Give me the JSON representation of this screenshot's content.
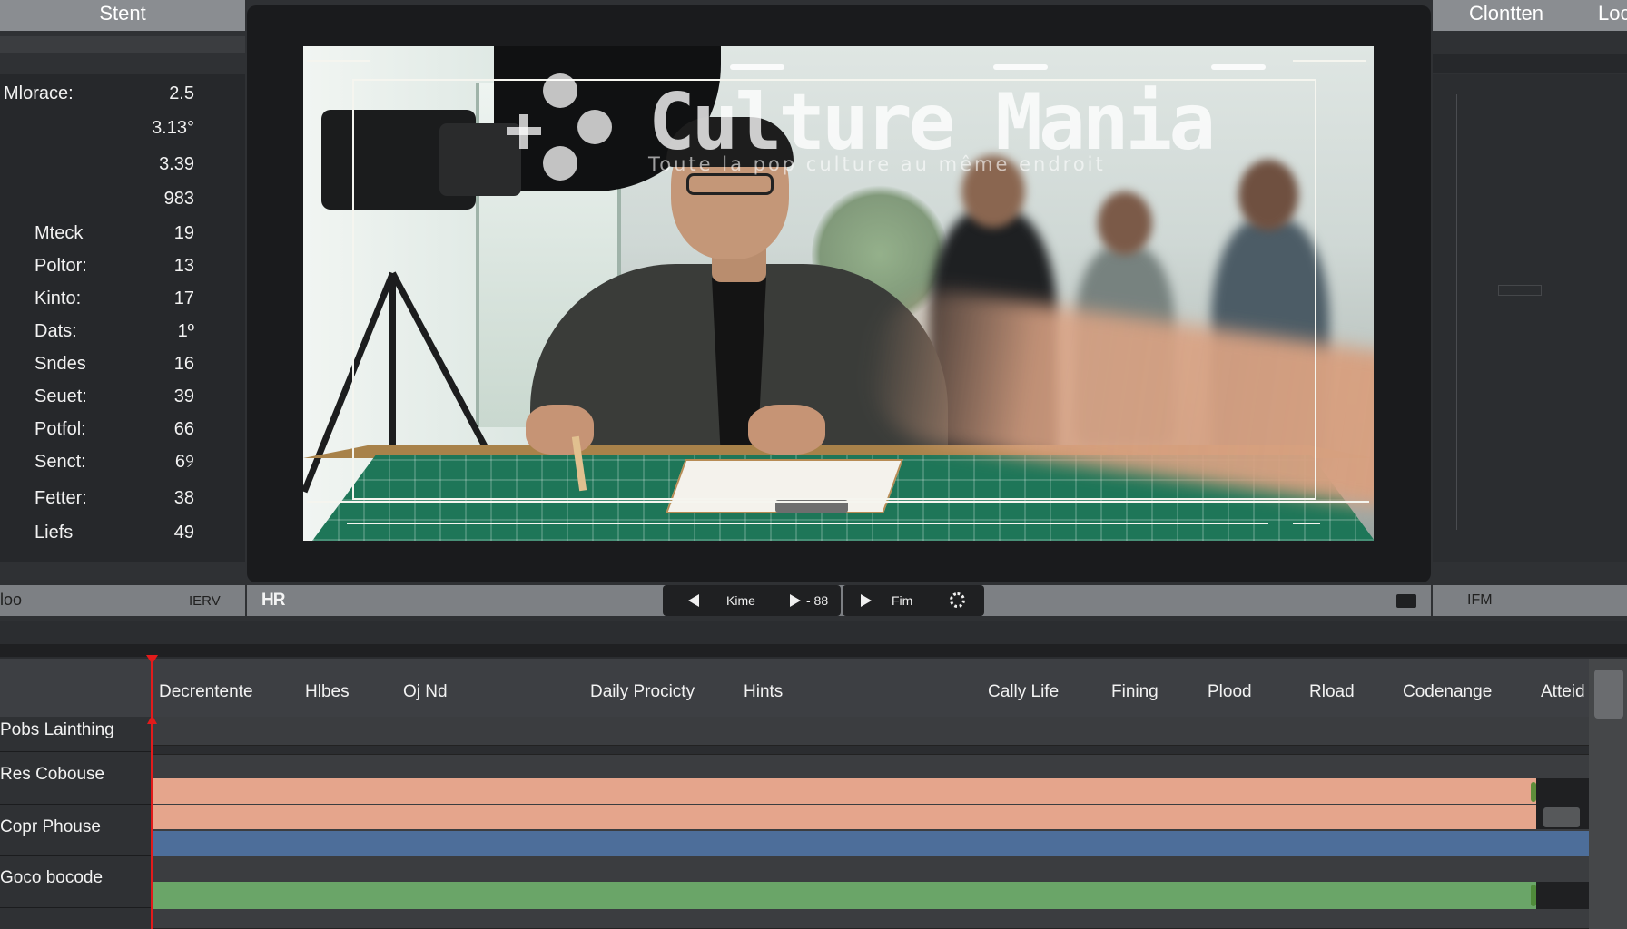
{
  "left_panel": {
    "title": "Stent",
    "properties": [
      {
        "label": "Mlorace:",
        "value": "2.5"
      },
      {
        "label": "",
        "value": "3.13°"
      },
      {
        "label": "",
        "value": "3.39"
      },
      {
        "label": "",
        "value": "983"
      },
      {
        "label": "Mteck",
        "value": "19"
      },
      {
        "label": "Poltor:",
        "value": "13"
      },
      {
        "label": "Kinto:",
        "value": "17"
      },
      {
        "label": "Dats:",
        "value": "1º"
      },
      {
        "label": "Sndes",
        "value": "16"
      },
      {
        "label": "Seuet:",
        "value": "39"
      },
      {
        "label": "Potfol:",
        "value": "66"
      },
      {
        "label": "Senct:",
        "value": "6୨"
      },
      {
        "label": "Fetter:",
        "value": "38"
      },
      {
        "label": "Liefs",
        "value": "49"
      }
    ],
    "footer_left": "loo",
    "footer_right": "IERV"
  },
  "viewer": {
    "watermark_title": "Culture Mania",
    "watermark_subtitle": "Toute la pop culture au même endroit"
  },
  "right_panel": {
    "title_a": "Clontten",
    "title_b": "Loc",
    "footer_label": "IFM"
  },
  "transport": {
    "logo": "HR",
    "prev_label": "Kime",
    "frame_label": "- 88",
    "play_label": "Fim",
    "icons": [
      "prev-icon",
      "next-icon",
      "play-icon",
      "gear-icon",
      "screen-icon"
    ]
  },
  "timeline": {
    "columns": [
      "Decrentente",
      "Hlbes",
      "Oj Nd",
      "Daily Procicty",
      "Hints",
      "Cally Life",
      "Fining",
      "Plood",
      "Rload",
      "Codenange",
      "Atteid"
    ],
    "tracks": [
      {
        "name": "Pobs Lainthing",
        "color": ""
      },
      {
        "name": "Res Cobouse",
        "color": "#e5a58c"
      },
      {
        "name": "Copr Phouse",
        "color": "#4d6e9a"
      },
      {
        "name": "Goco bocode",
        "color": "#6aa568"
      }
    ],
    "playhead_color": "#e21b1b"
  }
}
